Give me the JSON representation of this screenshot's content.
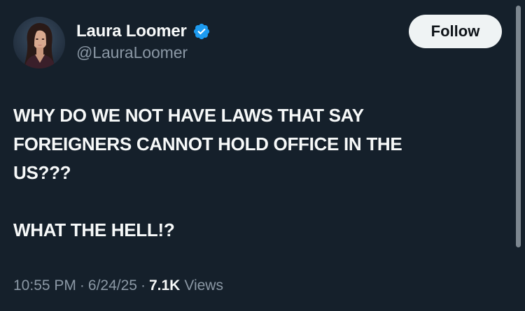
{
  "author": {
    "display_name": "Laura Loomer",
    "handle": "@LauraLoomer",
    "verified_icon": "verified-badge-icon",
    "avatar": "profile-photo"
  },
  "follow_button": {
    "label": "Follow"
  },
  "tweet": {
    "lines": [
      "WHY DO WE NOT HAVE LAWS THAT SAY",
      "FOREIGNERS CANNOT HOLD OFFICE IN THE",
      "US???",
      "",
      "WHAT THE HELL!?"
    ]
  },
  "meta": {
    "time": "10:55 PM",
    "separator": "·",
    "date": "6/24/25",
    "views_count": "7.1K",
    "views_label": "Views"
  },
  "colors": {
    "background": "#15202b",
    "text_primary": "#f7f9f9",
    "text_secondary": "#8b98a5",
    "verified": "#1d9bf0",
    "follow_button_bg": "#eff3f4",
    "follow_button_text": "#0f1419"
  }
}
